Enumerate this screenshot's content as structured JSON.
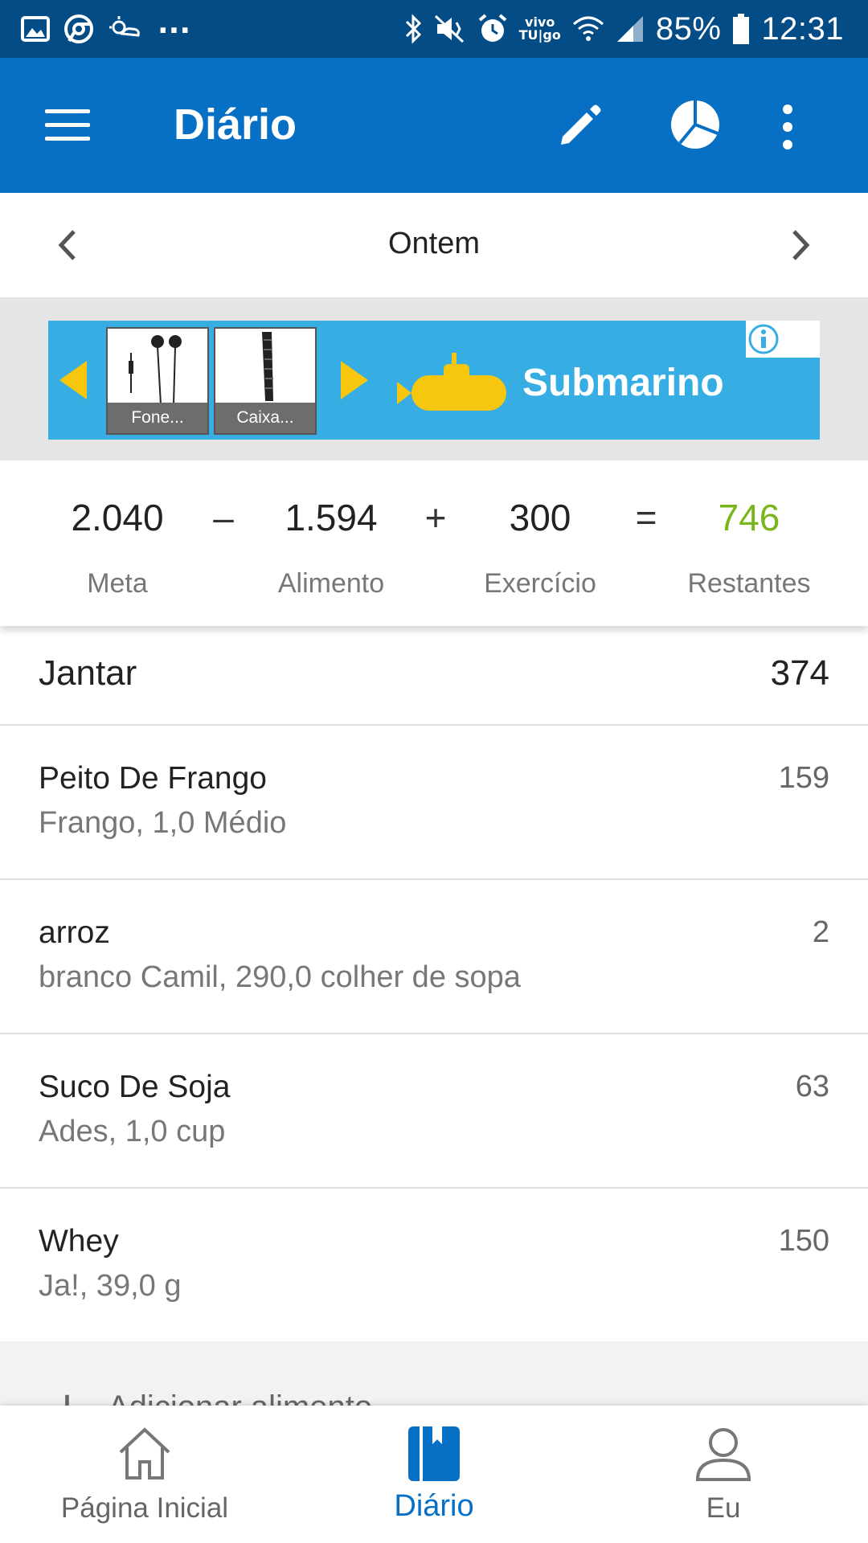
{
  "status_bar": {
    "carrier_top": "vivo",
    "carrier_bottom": "TU|go",
    "more": "...",
    "battery": "85%",
    "time": "12:31"
  },
  "app_bar": {
    "title": "Diário",
    "icons": [
      "menu-icon",
      "pencil-icon",
      "pie-chart-icon",
      "more-vert-icon"
    ]
  },
  "date_nav": {
    "label": "Ontem"
  },
  "ad": {
    "brand": "Submarino",
    "products": [
      {
        "caption": "Fone..."
      },
      {
        "caption": "Caixa..."
      }
    ],
    "colors": {
      "background": "#36ade3",
      "accent": "#f7c60f"
    }
  },
  "summary": {
    "goal_value": "2.040",
    "goal_label": "Meta",
    "minus": "–",
    "food_value": "1.594",
    "food_label": "Alimento",
    "plus": "+",
    "exercise_value": "300",
    "exercise_label": "Exercício",
    "equals": "=",
    "remaining_value": "746",
    "remaining_label": "Restantes",
    "remaining_color": "#7ab51d"
  },
  "meal": {
    "name": "Jantar",
    "total": "374",
    "items": [
      {
        "name": "Peito De Frango",
        "desc": "Frango, 1,0 Médio",
        "cal": "159"
      },
      {
        "name": "arroz",
        "desc": "branco Camil, 290,0 colher de sopa",
        "cal": "2"
      },
      {
        "name": "Suco De Soja",
        "desc": "Ades, 1,0 cup",
        "cal": "63"
      },
      {
        "name": "Whey",
        "desc": "Ja!, 39,0 g",
        "cal": "150"
      }
    ],
    "add_label": "Adicionar alimento"
  },
  "bottom_nav": {
    "items": [
      {
        "label": "Página Inicial",
        "icon": "home-icon"
      },
      {
        "label": "Diário",
        "icon": "diary-icon"
      },
      {
        "label": "Eu",
        "icon": "person-icon"
      }
    ],
    "active_color": "#0870c4"
  }
}
